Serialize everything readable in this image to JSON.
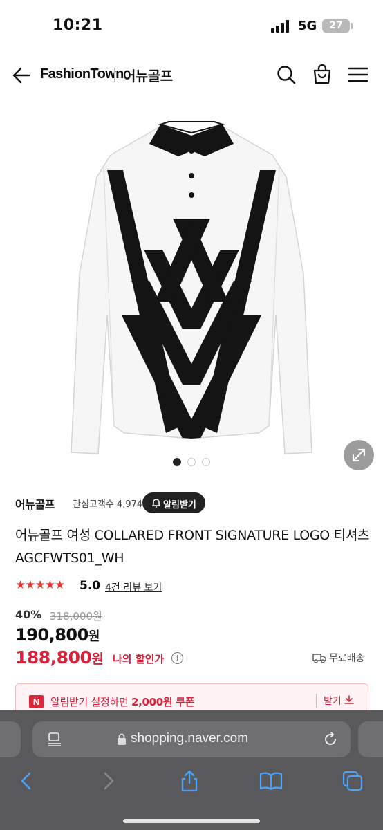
{
  "status_bar": {
    "time": "10:21",
    "network": "5G",
    "battery": "27"
  },
  "header": {
    "brand": "FashionTown",
    "shop_name": "어뉴골프",
    "icons": [
      "back-arrow-icon",
      "search-icon",
      "shopping-bag-icon",
      "menu-icon"
    ]
  },
  "carousel": {
    "page_count": 3,
    "active_index": 0
  },
  "store": {
    "name": "어뉴골프",
    "fans": "관심고객수 4,974",
    "alarm_button": "알림받기"
  },
  "product": {
    "title": "어뉴골프 여성 COLLARED FRONT SIGNATURE LOGO 티셔츠 AGCFWTS01_WH",
    "stars": "★★★★★",
    "rating": "5.0",
    "review_link": "4건 리뷰 보기",
    "discount": "40%",
    "original_price": "318,000원",
    "price": "190,800",
    "price_unit": "원",
    "my_price": "188,800",
    "my_price_unit": "원",
    "my_price_label": "나의 할인가",
    "info_symbol": "i",
    "shipping": "무료배송"
  },
  "coupon": {
    "badge": "N",
    "text_prefix": "알림받기 설정하면 ",
    "text_amount": "2,000원 쿠폰",
    "action": "받기"
  },
  "browser": {
    "url": "shopping.naver.com",
    "colors": {
      "bar": "#59595c",
      "field": "#6f6f72",
      "accent": "#4aa3ff"
    }
  },
  "colors": {
    "sale_red": "#d7223b",
    "star_red": "#e53935"
  }
}
